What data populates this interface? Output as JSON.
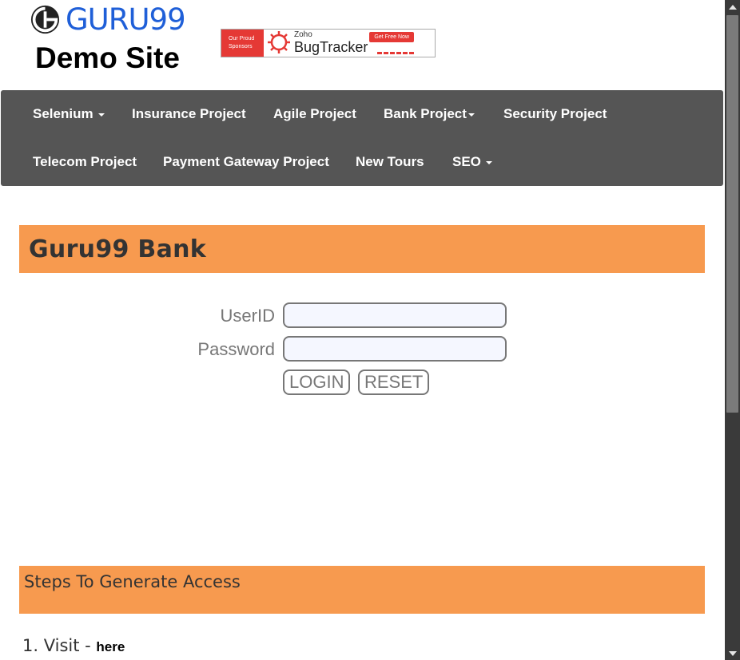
{
  "header": {
    "logo_text": "GURU99",
    "subtitle": "Demo Site",
    "sponsor": {
      "left_text_1": "Our Proud",
      "left_text_2": "Sponsors",
      "brand_small": "Zoho",
      "brand_big": "BugTracker",
      "cta": "Get Free Now"
    }
  },
  "nav": {
    "items": [
      {
        "label": "Selenium"
      },
      {
        "label": "Insurance Project"
      },
      {
        "label": "Agile Project"
      },
      {
        "label": "Bank Project"
      },
      {
        "label": "Security Project"
      },
      {
        "label": "Telecom Project"
      },
      {
        "label": "Payment Gateway Project"
      },
      {
        "label": "New Tours"
      },
      {
        "label": "SEO"
      }
    ]
  },
  "main": {
    "title": "Guru99 Bank",
    "form": {
      "userid_label": "UserID",
      "userid_value": "",
      "password_label": "Password",
      "password_value": "",
      "login_label": "LOGIN",
      "reset_label": "RESET"
    },
    "steps": {
      "heading": "Steps To Generate Access",
      "item1_prefix": "1. Visit - ",
      "item1_link": "here"
    }
  },
  "colors": {
    "accent_orange": "#f79a4f",
    "nav_bg": "#555555",
    "logo_blue": "#1f5fd8"
  },
  "icons": {
    "logo": "guru99-logo-icon",
    "sponsor": "bugtracker-gear-icon"
  }
}
